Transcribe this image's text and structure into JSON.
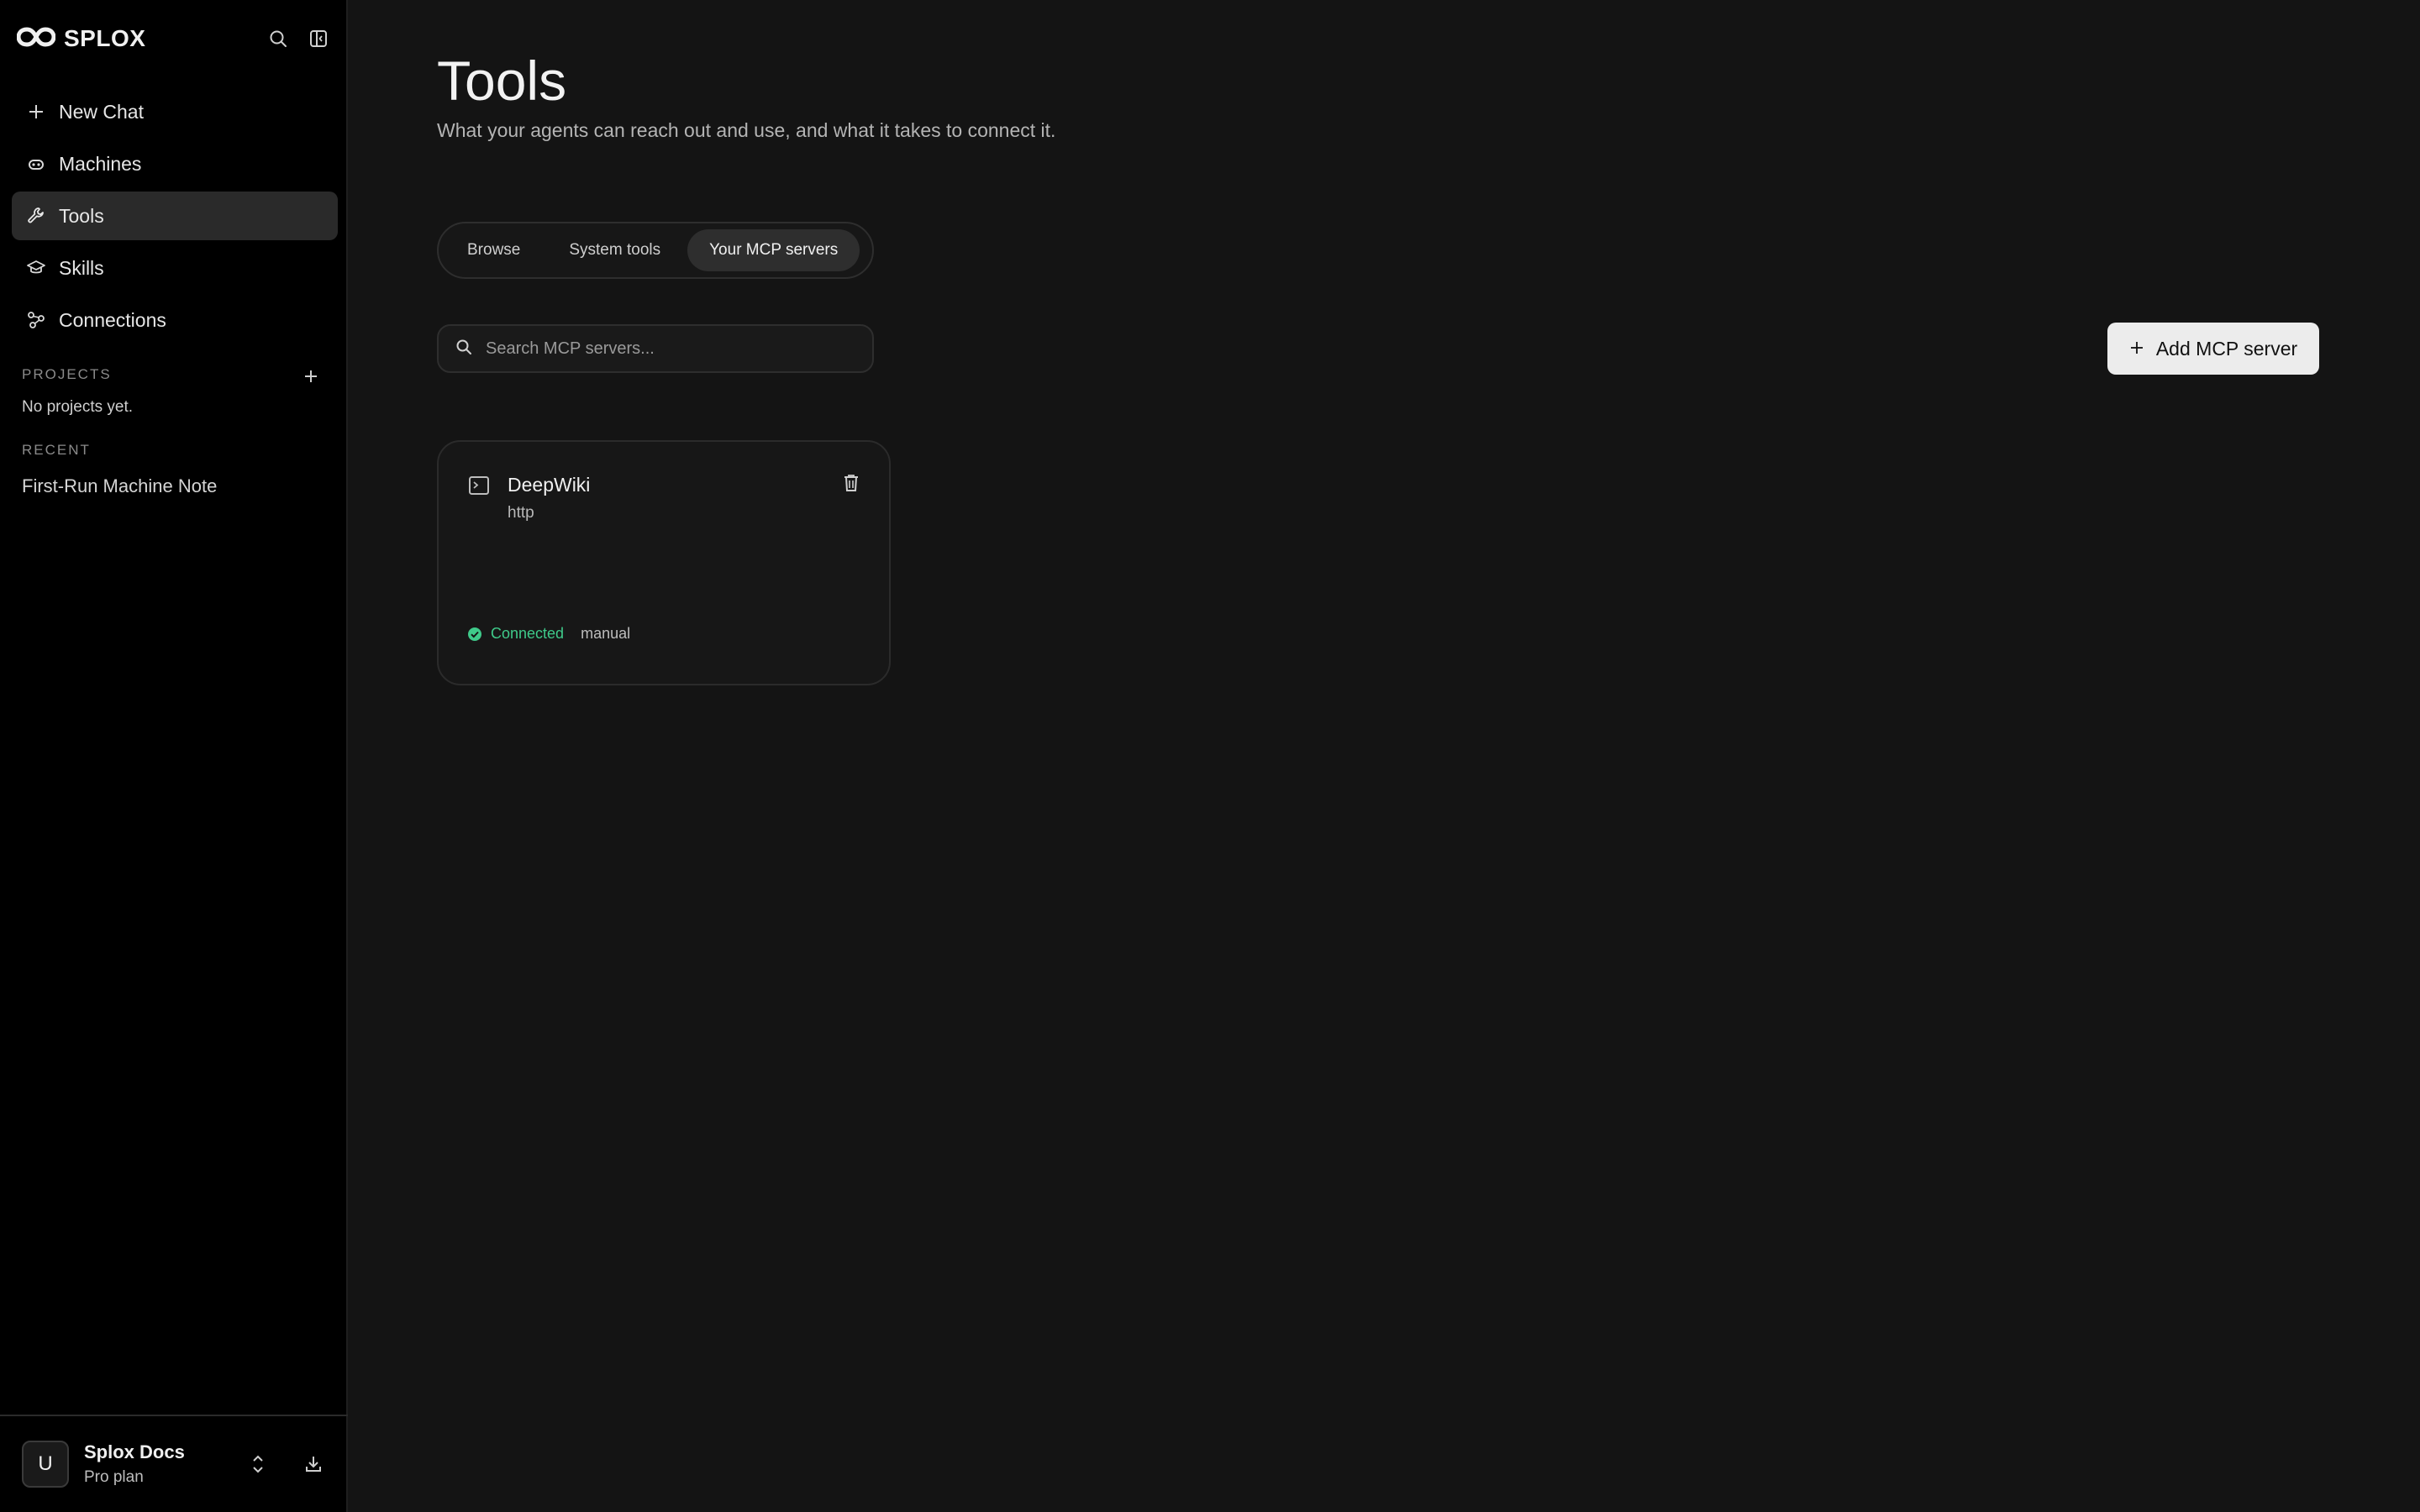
{
  "brand": {
    "name": "SPLOX"
  },
  "nav": {
    "items": [
      {
        "label": "New Chat",
        "icon": "plus-icon"
      },
      {
        "label": "Machines",
        "icon": "robot-icon"
      },
      {
        "label": "Tools",
        "icon": "wrench-icon",
        "active": true
      },
      {
        "label": "Skills",
        "icon": "graduation-cap-icon"
      },
      {
        "label": "Connections",
        "icon": "connections-icon"
      }
    ]
  },
  "projects": {
    "label": "PROJECTS",
    "empty": "No projects yet."
  },
  "recent": {
    "label": "RECENT",
    "items": [
      "First-Run Machine Note"
    ]
  },
  "account": {
    "initial": "U",
    "name": "Splox Docs",
    "plan": "Pro plan"
  },
  "page": {
    "title": "Tools",
    "subtitle": "What your agents can reach out and use, and what it takes to connect it."
  },
  "tabs": [
    {
      "label": "Browse"
    },
    {
      "label": "System tools"
    },
    {
      "label": "Your MCP servers",
      "active": true
    }
  ],
  "search": {
    "placeholder": "Search MCP servers..."
  },
  "add_button": {
    "label": "Add MCP server"
  },
  "servers": [
    {
      "name": "DeepWiki",
      "type": "http",
      "status": "Connected",
      "mode": "manual"
    }
  ],
  "colors": {
    "status_connected": "#3fca8a",
    "active_bg": "#2a2a2a"
  }
}
